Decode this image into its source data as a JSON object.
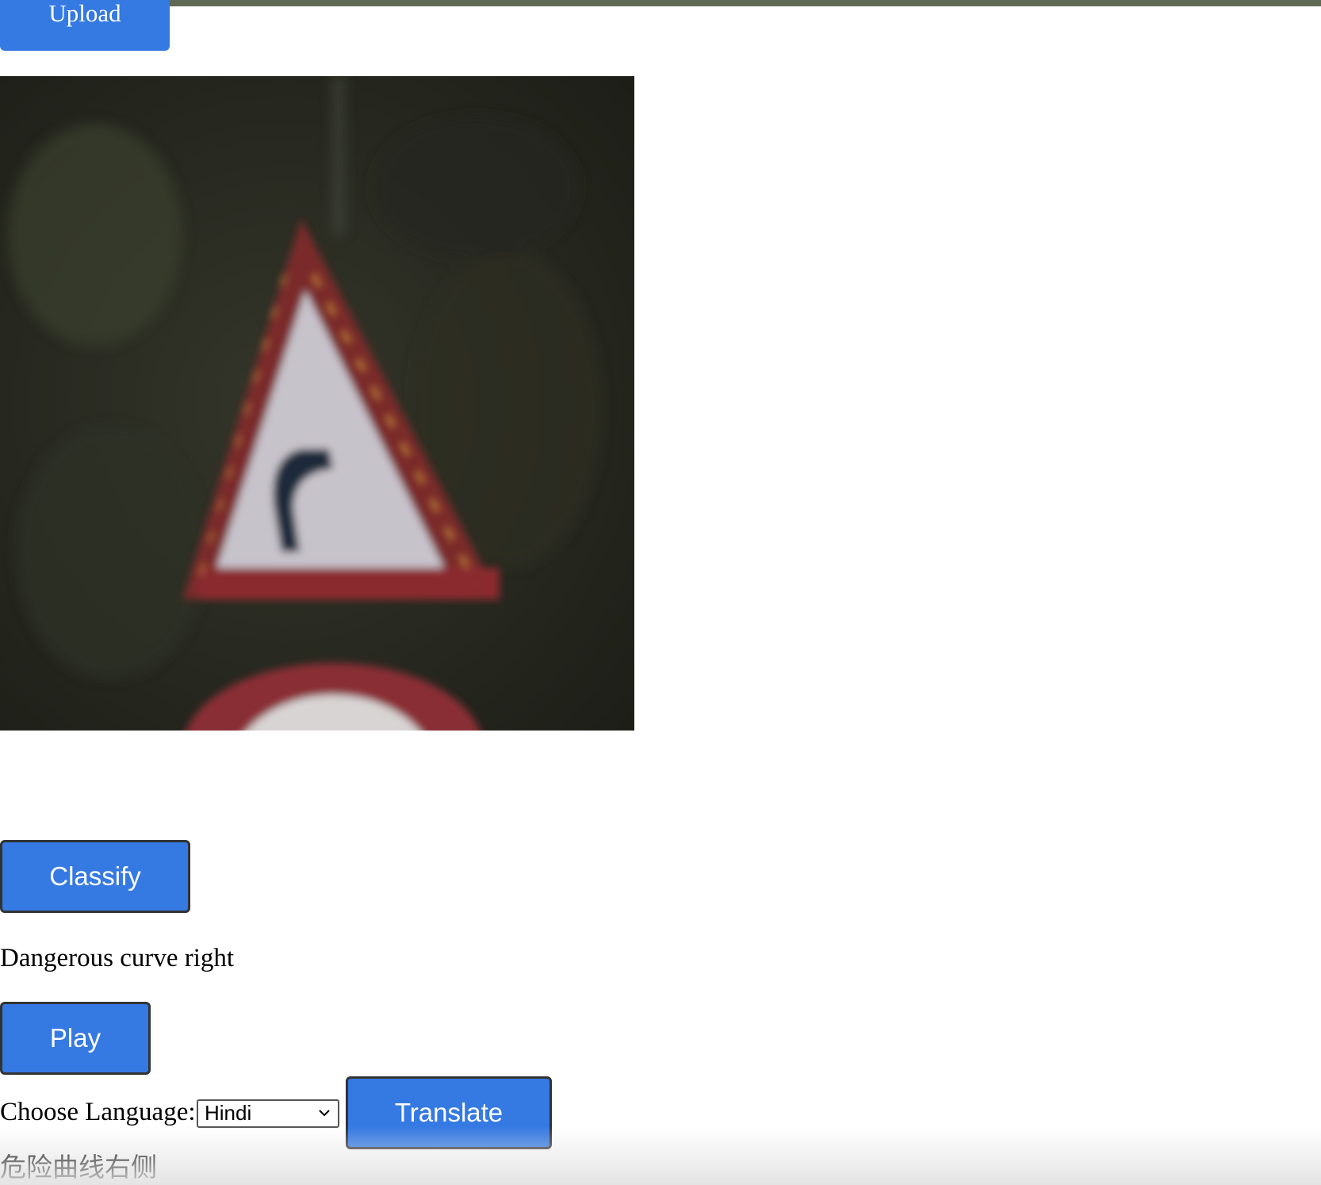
{
  "upload": {
    "label": "Upload"
  },
  "image": {
    "icon": "traffic-sign-image"
  },
  "classify": {
    "label": "Classify"
  },
  "result": {
    "text": "Dangerous curve right"
  },
  "play": {
    "label": "Play"
  },
  "language": {
    "label": "Choose Language:",
    "selected": "Hindi"
  },
  "translate": {
    "label": "Translate"
  },
  "translation": {
    "text": "危险曲线右侧"
  },
  "colors": {
    "button": "#3579e3",
    "topbar": "#5f6a55"
  }
}
